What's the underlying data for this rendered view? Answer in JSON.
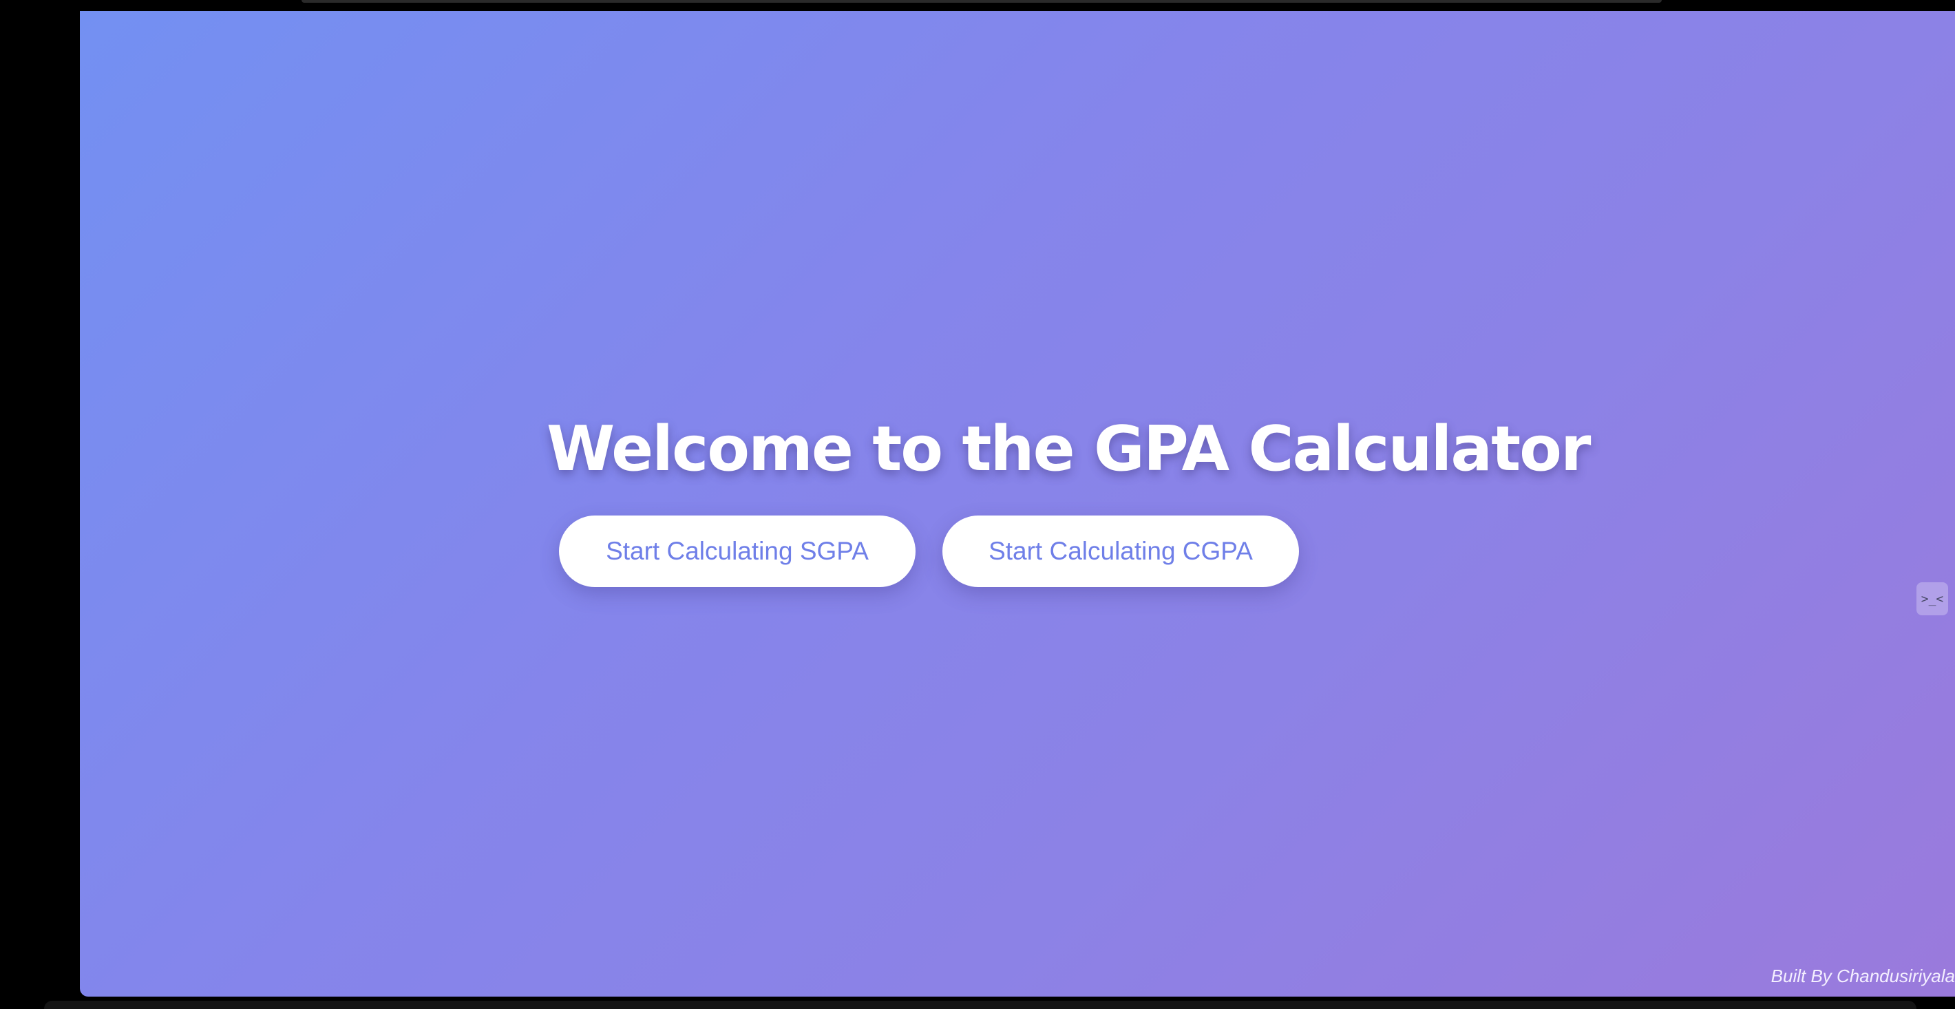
{
  "page": {
    "title": "Welcome to the GPA Calculator",
    "footer_credit": "Built By Chandusiriyala"
  },
  "actions": {
    "sgpa_label": "Start Calculating SGPA",
    "cgpa_label": "Start Calculating CGPA"
  },
  "side_widget": {
    "icon": "sleepy-face-icon",
    "glyph": ">_<"
  },
  "colors": {
    "gradient_start": "#7390f2",
    "gradient_end": "#9a7adc",
    "button_background": "#ffffff",
    "button_text": "#6f7fe8",
    "title_text": "#ffffff"
  }
}
